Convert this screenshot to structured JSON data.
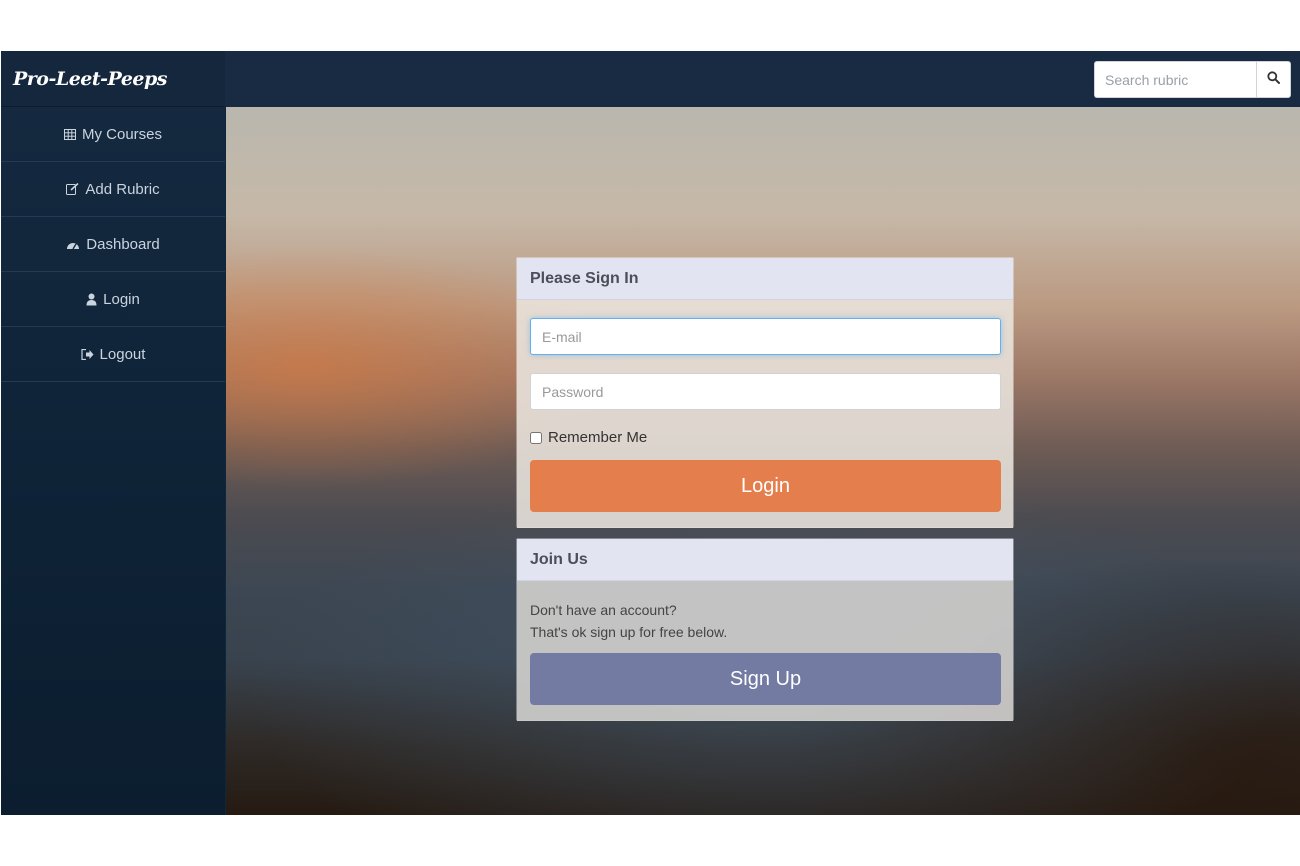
{
  "brand": {
    "name": "Pro-Leet-Peeps"
  },
  "search": {
    "placeholder": "Search rubric",
    "icon": "search-icon"
  },
  "sidebar": {
    "items": [
      {
        "label": "My Courses",
        "icon": "table-icon"
      },
      {
        "label": "Add Rubric",
        "icon": "edit-icon"
      },
      {
        "label": "Dashboard",
        "icon": "dashboard-icon"
      },
      {
        "label": "Login",
        "icon": "user-icon"
      },
      {
        "label": "Logout",
        "icon": "sign-out-icon"
      }
    ]
  },
  "signin": {
    "title": "Please Sign In",
    "email_placeholder": "E-mail",
    "password_placeholder": "Password",
    "remember_label": "Remember Me",
    "login_button": "Login"
  },
  "join": {
    "title": "Join Us",
    "line1": "Don't have an account?",
    "line2": "That's ok sign up for free below.",
    "signup_button": "Sign Up"
  },
  "colors": {
    "nav_background": "#182b42",
    "sidebar_background": "#0e2236",
    "login_button": "#e47f4d",
    "signup_button": "#737ba3",
    "panel_heading": "#e3e4f2"
  }
}
